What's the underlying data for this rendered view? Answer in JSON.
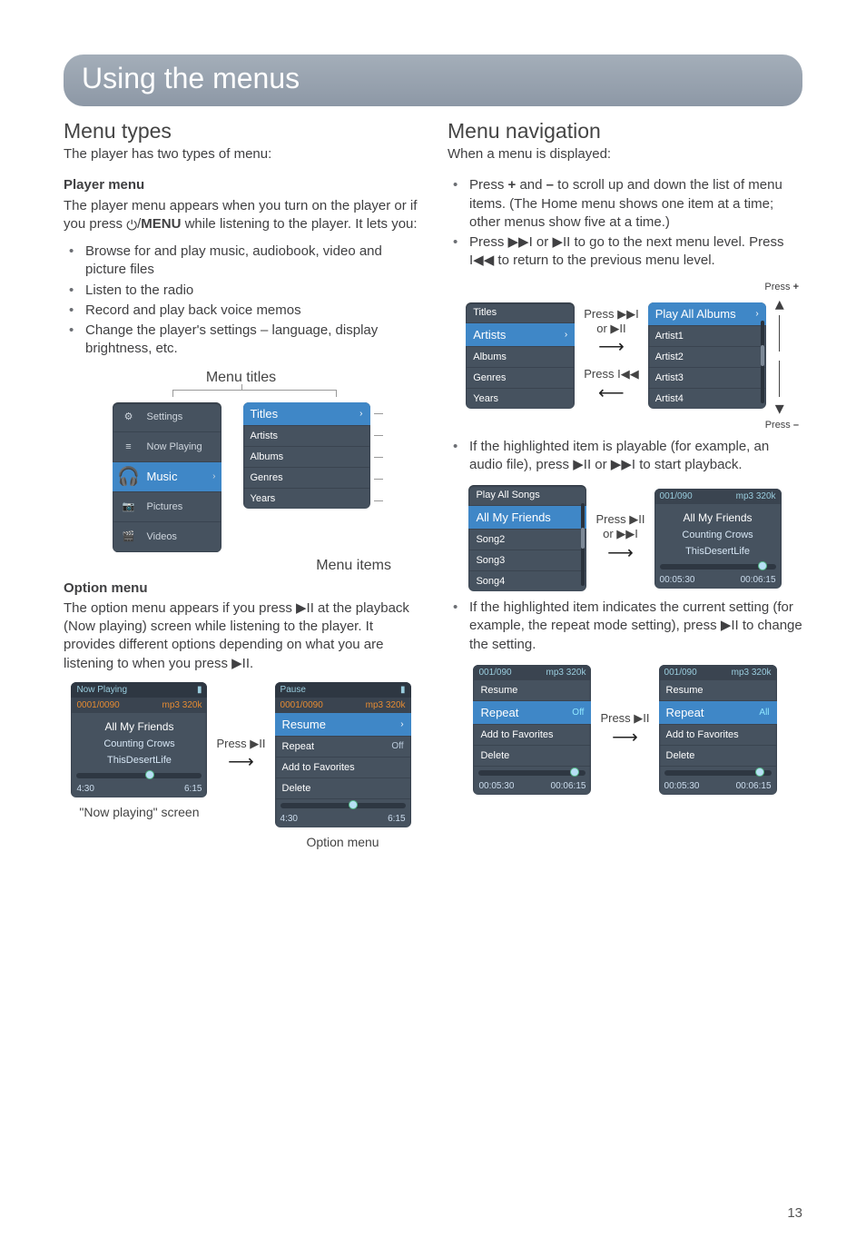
{
  "page_number": "13",
  "banner_title": "Using the menus",
  "left": {
    "h2": "Menu types",
    "lead": "The player has two types of menu:",
    "player_menu_head": "Player menu",
    "player_menu_p": "The player menu appears when you turn on the player or if you press ⏻/MENU while listening to the player. It lets you:",
    "player_bullets": [
      "Browse for and play music, audiobook, video and picture files",
      "Listen to the radio",
      "Record and play back voice memos",
      "Change the player's settings – language, display brightness, etc."
    ],
    "fig1_title": "Menu titles",
    "fig1_items_caption": "Menu items",
    "home_menu": [
      "Settings",
      "Now Playing",
      "Music",
      "Pictures",
      "Videos"
    ],
    "music_menu": [
      "Titles",
      "Artists",
      "Albums",
      "Genres",
      "Years"
    ],
    "option_head": "Option menu",
    "option_p": "The option menu appears if you press ▶II at the playback (Now playing) screen while listening to the player. It provides different options depending on what you are listening to when you press ▶II.",
    "nowplaying_title": "Now Playing",
    "np_counter": "0001/0090",
    "np_bitrate": "mp3 320k",
    "np_song": "All My Friends",
    "np_artist": "Counting Crows",
    "np_album": "ThisDesertLife",
    "np_t1": "4:30",
    "np_t2": "6:15",
    "np_caption": "\"Now playing\" screen",
    "press_play": "Press ▶II",
    "opt_title": "Pause",
    "opt_resume": "Resume",
    "opt_repeat": "Repeat",
    "opt_repeat_val": "Off",
    "opt_fav": "Add to Favorites",
    "opt_del": "Delete",
    "opt_caption": "Option menu"
  },
  "right": {
    "h2": "Menu navigation",
    "lead": "When a menu is displayed:",
    "b1": "Press + and – to scroll up and down the list of menu items. (The Home menu shows one item at a time; other menus show five at a time.)",
    "b2": "Press ▶▶I or ▶II to go to the next menu level. Press I◀◀ to return to the previous menu level.",
    "fig_nav_left": [
      "Titles",
      "Artists",
      "Albums",
      "Genres",
      "Years"
    ],
    "fig_nav_right": [
      "Play All Albums",
      "Artist1",
      "Artist2",
      "Artist3",
      "Artist4"
    ],
    "press_next": "Press ▶▶I",
    "or_play": "or ▶II",
    "press_prev": "Press I◀◀",
    "press_plus": "Press +",
    "press_minus": "Press –",
    "b3": "If the highlighted item is playable (for example, an audio file), press ▶II or ▶▶I to start playback.",
    "songs_menu": [
      "Play All Songs",
      "All My Friends",
      "Song2",
      "Song3",
      "Song4"
    ],
    "press_play2": "Press ▶II",
    "or_next": "or ▶▶I",
    "np2_counter": "001/090",
    "np2_bitrate": "mp3 320k",
    "np2_song": "All My Friends",
    "np2_artist": "Counting Crows",
    "np2_album": "ThisDesertLife",
    "np2_t1": "00:05:30",
    "np2_t2": "00:06:15",
    "b4": "If the highlighted item indicates the current setting (for example, the repeat mode setting), press ▶II to change the setting.",
    "opt3_counter": "001/090",
    "opt3_bitrate": "mp3 320k",
    "opt3_resume": "Resume",
    "opt3_repeat": "Repeat",
    "opt3_repeat_off": "Off",
    "opt3_repeat_all": "All",
    "opt3_fav": "Add to Favorites",
    "opt3_del": "Delete",
    "opt3_t1": "00:05:30",
    "opt3_t2": "00:06:15",
    "press_play3": "Press ▶II"
  }
}
